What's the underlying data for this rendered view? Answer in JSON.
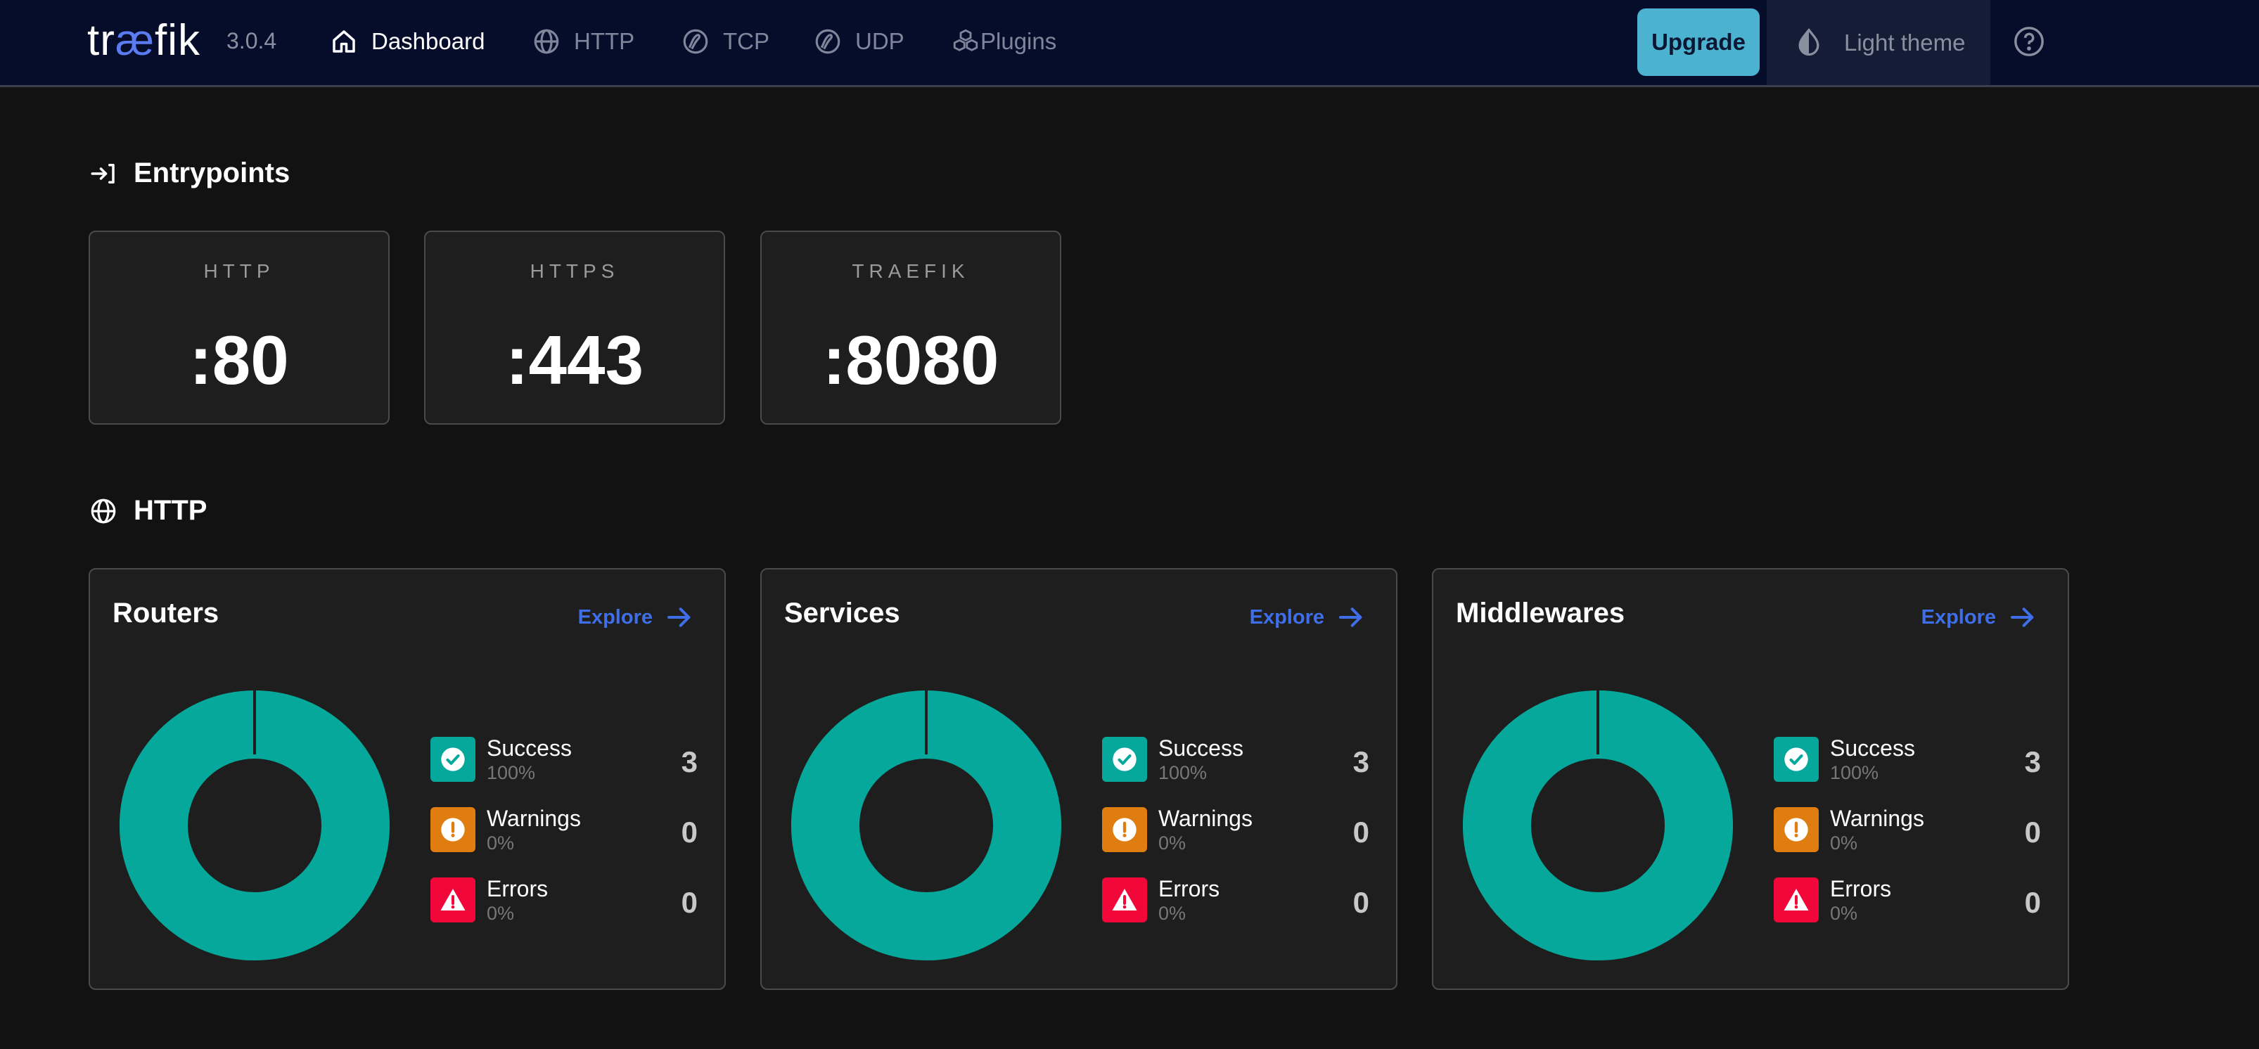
{
  "nav": {
    "logo_left": "tr",
    "logo_ae": "æ",
    "logo_right": "fik",
    "version": "3.0.4",
    "items": [
      {
        "label": "Dashboard",
        "icon": "home-icon",
        "active": true
      },
      {
        "label": "HTTP",
        "icon": "globe-icon",
        "active": false
      },
      {
        "label": "TCP",
        "icon": "tcp-icon",
        "active": false
      },
      {
        "label": "UDP",
        "icon": "udp-icon",
        "active": false
      },
      {
        "label": "Plugins",
        "icon": "plugins-icon",
        "active": false
      }
    ],
    "upgrade_label": "Upgrade",
    "theme_label": "Light theme"
  },
  "entrypoints": {
    "heading": "Entrypoints",
    "items": [
      {
        "name": "HTTP",
        "port": ":80"
      },
      {
        "name": "HTTPS",
        "port": ":443"
      },
      {
        "name": "TRAEFIK",
        "port": ":8080"
      }
    ]
  },
  "http": {
    "heading": "HTTP",
    "explore_label": "Explore",
    "cards": [
      {
        "title": "Routers",
        "success": {
          "label": "Success",
          "percent": "100%",
          "count": "3"
        },
        "warnings": {
          "label": "Warnings",
          "percent": "0%",
          "count": "0"
        },
        "errors": {
          "label": "Errors",
          "percent": "0%",
          "count": "0"
        }
      },
      {
        "title": "Services",
        "success": {
          "label": "Success",
          "percent": "100%",
          "count": "3"
        },
        "warnings": {
          "label": "Warnings",
          "percent": "0%",
          "count": "0"
        },
        "errors": {
          "label": "Errors",
          "percent": "0%",
          "count": "0"
        }
      },
      {
        "title": "Middlewares",
        "success": {
          "label": "Success",
          "percent": "100%",
          "count": "3"
        },
        "warnings": {
          "label": "Warnings",
          "percent": "0%",
          "count": "0"
        },
        "errors": {
          "label": "Errors",
          "percent": "0%",
          "count": "0"
        }
      }
    ]
  },
  "colors": {
    "success": "#05a89a",
    "warning": "#e07d10",
    "error": "#f2073a",
    "accent": "#3e6ee8",
    "nav_bg": "#050d2b",
    "upgrade_bg": "#4bb3cf"
  }
}
